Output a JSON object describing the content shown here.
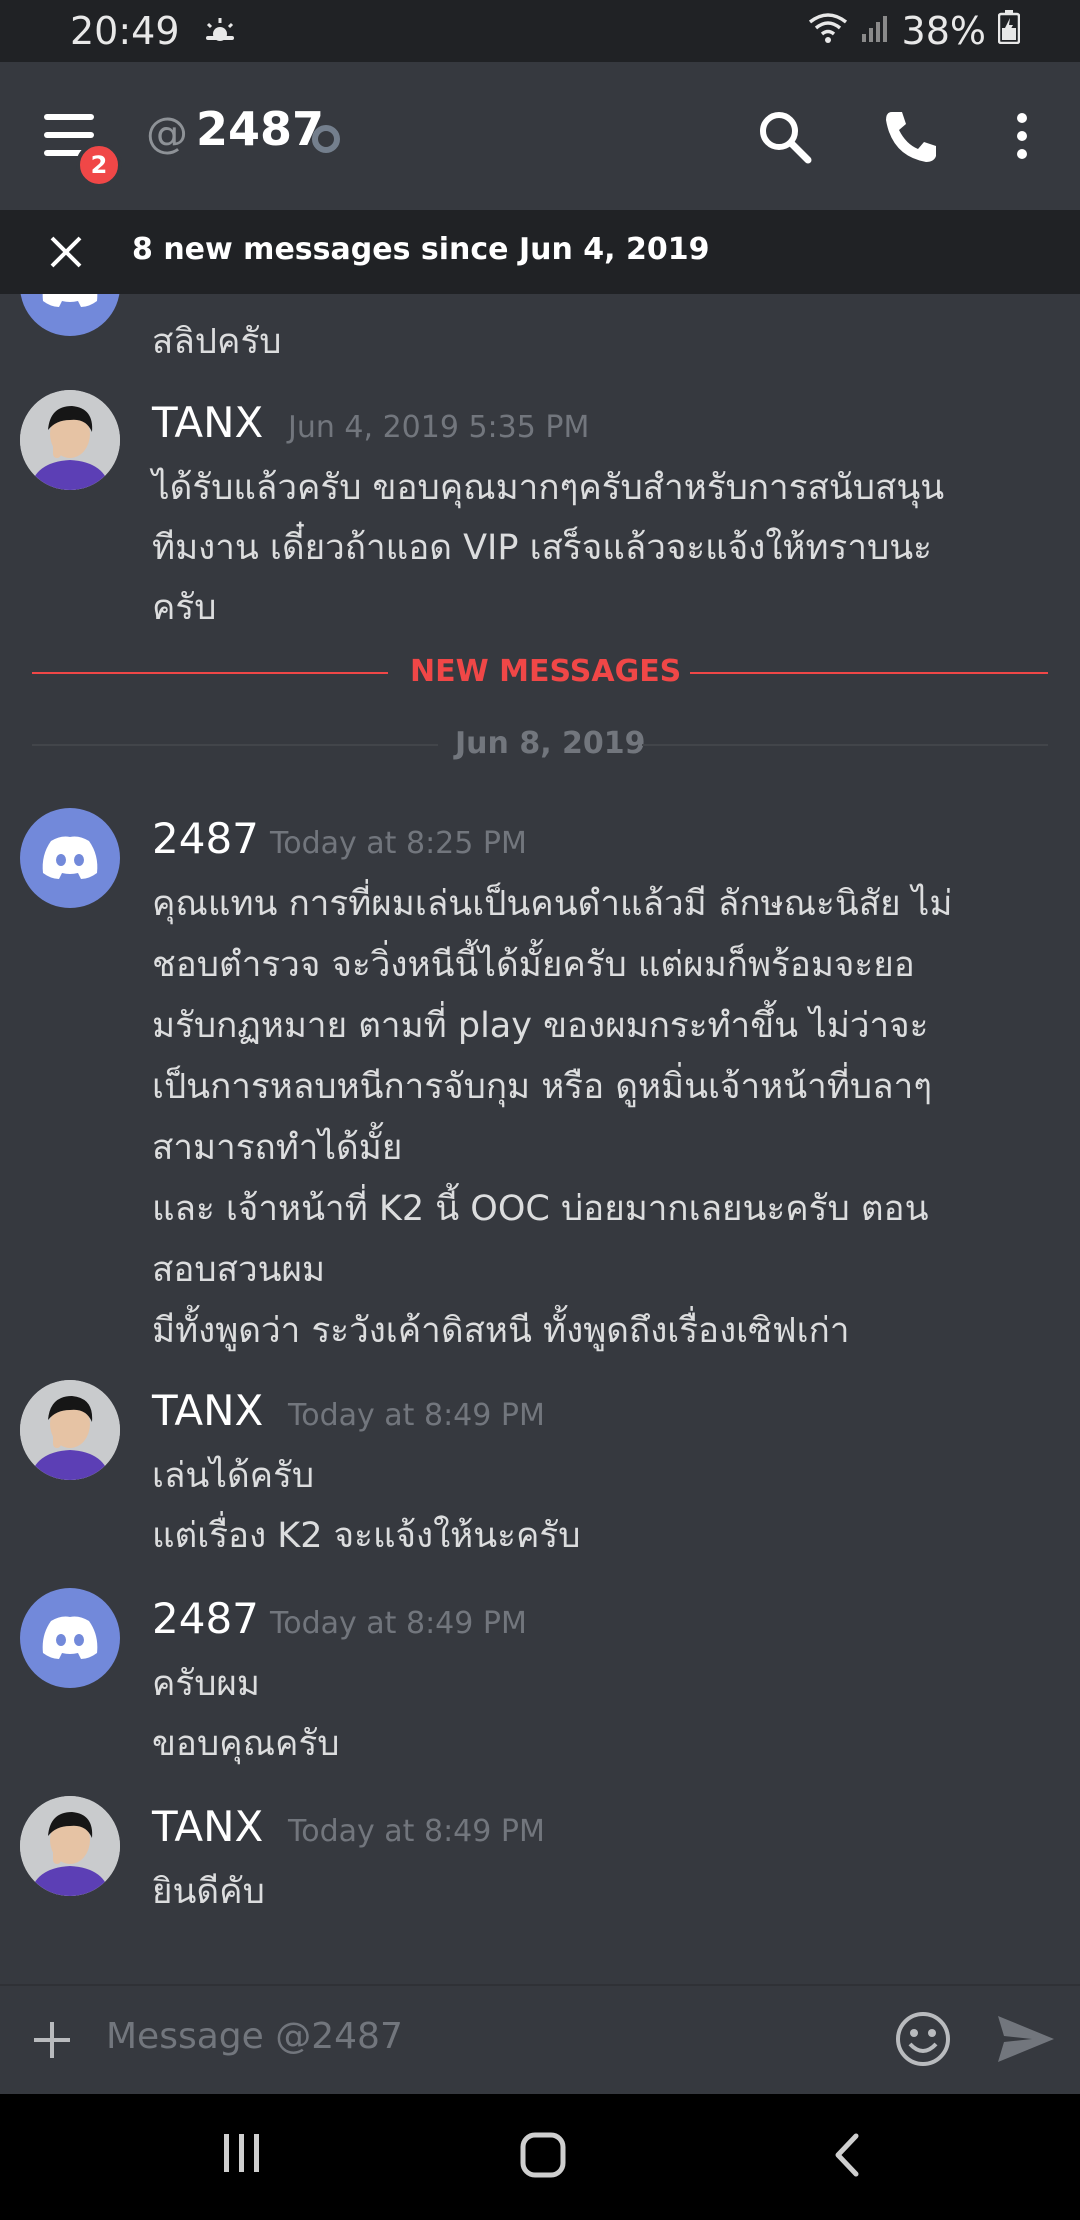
{
  "status_bar": {
    "time": "20:49",
    "battery": "38%"
  },
  "header": {
    "at_symbol": "@",
    "channel_name": "2487",
    "notification_count": "2"
  },
  "new_messages_bar": {
    "text": "8 new messages since Jun 4, 2019"
  },
  "messages": [
    {
      "author": "",
      "timestamp": "",
      "lines": [
        "สลิปครับ"
      ]
    },
    {
      "author": "TANX",
      "timestamp": "Jun 4, 2019 5:35 PM",
      "lines": [
        "ได้รับแล้วครับ ขอบคุณมากๆครับสำหรับการสนับสนุน",
        "ทีมงาน เดี๋ยวถ้าแอด VIP เสร็จแล้วจะแจ้งให้ทราบนะ",
        "ครับ"
      ]
    },
    {
      "author": "2487",
      "timestamp": "Today at 8:25 PM",
      "lines": [
        "คุณแทน การที่ผมเล่นเป็นคนดำแล้วมี ลักษณะนิสัย ไม่",
        "ชอบตำรวจ จะวิ่งหนีนี้ได้มั้ยครับ แต่ผมก็พร้อมจะยอ",
        "มรับกฏหมาย ตามที่ play ของผมกระทำขึ้น ไม่ว่าจะ",
        "เป็นการหลบหนีการจับกุม หรือ ดูหมิ่นเจ้าหน้าที่บลาๆ",
        "สามารถทำได้มั้ย",
        "และ เจ้าหน้าที่ K2 นี้ OOC บ่อยมากเลยนะครับ ตอน",
        "สอบสวนผม",
        "มีทั้งพูดว่า ระวังเค้าดิสหนี ทั้งพูดถึงเรื่องเซิฟเก่า"
      ]
    },
    {
      "author": "TANX",
      "timestamp": "Today at 8:49 PM",
      "lines": [
        "เล่นได้ครับ",
        "แต่เรื่อง K2 จะแจ้งให้นะครับ"
      ]
    },
    {
      "author": "2487",
      "timestamp": "Today at 8:49 PM",
      "lines": [
        "ครับผม",
        "ขอบคุณครับ"
      ]
    },
    {
      "author": "TANX",
      "timestamp": "Today at 8:49 PM",
      "lines": [
        "ยินดีคับ"
      ]
    }
  ],
  "dividers": {
    "new_messages": "NEW MESSAGES",
    "date": "Jun 8, 2019"
  },
  "composer": {
    "placeholder": "Message @2487"
  },
  "colors": {
    "background": "#36393f",
    "header_dark": "#202225",
    "accent_red": "#f04747",
    "blurple": "#7289da",
    "muted_text": "#72767d"
  },
  "icons": [
    "menu-icon",
    "search-icon",
    "phone-icon",
    "more-vertical-icon",
    "close-icon",
    "plus-icon",
    "emoji-icon",
    "send-icon",
    "recents-icon",
    "home-icon",
    "back-icon",
    "wifi-icon",
    "signal-icon",
    "battery-icon",
    "weather-icon"
  ]
}
